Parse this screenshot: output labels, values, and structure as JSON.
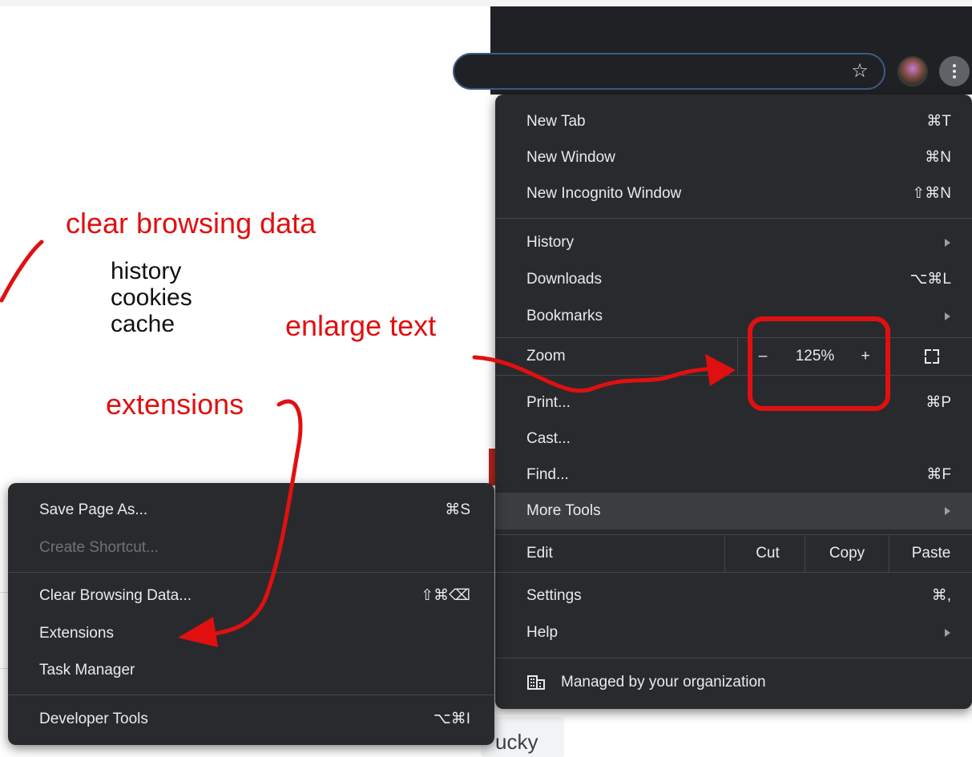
{
  "toolbar": {
    "star_icon": "star-icon",
    "avatar_icon": "avatar",
    "menu_icon": "kebab-menu-icon"
  },
  "menu": {
    "items": [
      {
        "label": "New Tab",
        "shortcut": "⌘T"
      },
      {
        "label": "New Window",
        "shortcut": "⌘N"
      },
      {
        "label": "New Incognito Window",
        "shortcut": "⇧⌘N"
      },
      {
        "label": "History"
      },
      {
        "label": "Downloads",
        "shortcut": "⌥⌘L"
      },
      {
        "label": "Bookmarks"
      },
      {
        "label": "Zoom"
      },
      {
        "label": "Print...",
        "shortcut": "⌘P"
      },
      {
        "label": "Cast..."
      },
      {
        "label": "Find...",
        "shortcut": "⌘F"
      },
      {
        "label": "More Tools"
      },
      {
        "label": "Edit"
      },
      {
        "label": "Settings",
        "shortcut": "⌘,"
      },
      {
        "label": "Help"
      }
    ],
    "zoom": {
      "minus": "–",
      "value": "125%",
      "plus": "+"
    },
    "edit": {
      "cut": "Cut",
      "copy": "Copy",
      "paste": "Paste"
    },
    "managed": "Managed by your organization"
  },
  "submenu": {
    "items": [
      {
        "label": "Save Page As...",
        "shortcut": "⌘S"
      },
      {
        "label": "Create Shortcut..."
      },
      {
        "label": "Clear Browsing Data...",
        "shortcut": "⇧⌘⌫"
      },
      {
        "label": "Extensions"
      },
      {
        "label": "Task Manager"
      },
      {
        "label": "Developer Tools",
        "shortcut": "⌥⌘I"
      }
    ]
  },
  "page": {
    "button_text": "ucky"
  },
  "annotations": {
    "clear": "clear browsing data",
    "list": [
      "history",
      "cookies",
      "cache"
    ],
    "enlarge": "enlarge text",
    "extensions": "extensions",
    "color": "#e01010"
  }
}
